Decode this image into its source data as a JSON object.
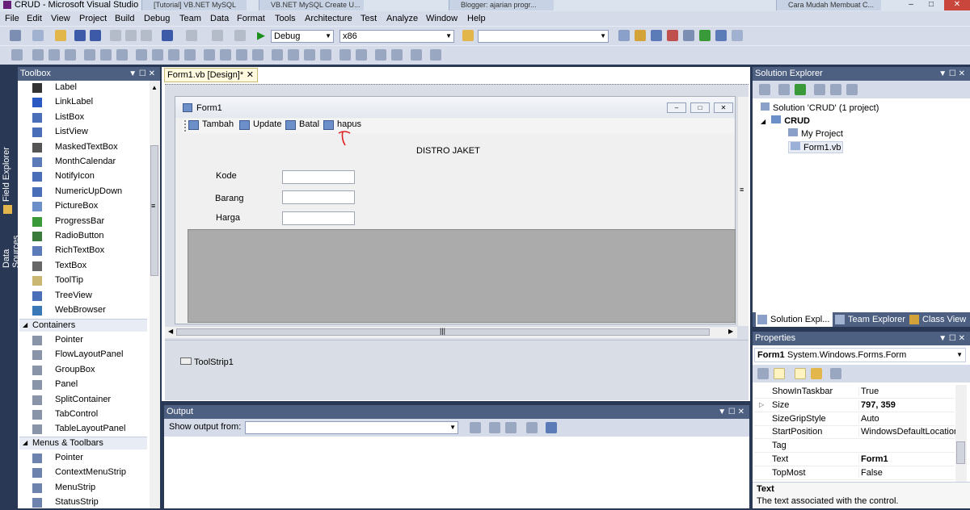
{
  "window": {
    "title": "CRUD - Microsoft Visual Studio",
    "browser_tabs": [
      "[Tutorial] VB.NET MySQL",
      "VB.NET MySQL Create U...",
      "Blogger: ajarian progr...",
      "Cara Mudah Membuat C..."
    ]
  },
  "menubar": {
    "items": [
      "File",
      "Edit",
      "View",
      "Project",
      "Build",
      "Debug",
      "Team",
      "Data",
      "Format",
      "Tools",
      "Architecture",
      "Test",
      "Analyze",
      "Window",
      "Help"
    ]
  },
  "toolbar": {
    "config": "Debug",
    "platform": "x86",
    "search": ""
  },
  "left_strip": {
    "items": [
      "Field Explorer",
      "Data Sources"
    ]
  },
  "toolbox": {
    "title": "Toolbox",
    "common_items": [
      "Label",
      "LinkLabel",
      "ListBox",
      "ListView",
      "MaskedTextBox",
      "MonthCalendar",
      "NotifyIcon",
      "NumericUpDown",
      "PictureBox",
      "ProgressBar",
      "RadioButton",
      "RichTextBox",
      "TextBox",
      "ToolTip",
      "TreeView",
      "WebBrowser"
    ],
    "containers_header": "Containers",
    "containers_items": [
      "Pointer",
      "FlowLayoutPanel",
      "GroupBox",
      "Panel",
      "SplitContainer",
      "TabControl",
      "TableLayoutPanel"
    ],
    "menus_header": "Menus & Toolbars",
    "menus_items": [
      "Pointer",
      "ContextMenuStrip",
      "MenuStrip",
      "StatusStrip"
    ]
  },
  "designer": {
    "tab_label": "Form1.vb [Design]*",
    "form_title": "Form1",
    "toolstrip_buttons": [
      "Tambah",
      "Update",
      "Batal",
      "hapus"
    ],
    "heading": "DISTRO JAKET",
    "fields": [
      {
        "label": "Kode",
        "value": ""
      },
      {
        "label": "Barang",
        "value": ""
      },
      {
        "label": "Harga",
        "value": ""
      }
    ],
    "tray_component": "ToolStrip1"
  },
  "output": {
    "title": "Output",
    "show_from_label": "Show output from:",
    "source": ""
  },
  "solution_explorer": {
    "title": "Solution Explorer",
    "solution": "Solution 'CRUD' (1 project)",
    "project": "CRUD",
    "items": [
      "My Project",
      "Form1.vb"
    ],
    "bottom_tabs": [
      "Solution Expl...",
      "Team Explorer",
      "Class View"
    ]
  },
  "properties": {
    "title": "Properties",
    "object_name": "Form1",
    "object_type": "System.Windows.Forms.Form",
    "rows": [
      {
        "name": "ShowInTaskbar",
        "value": "True",
        "bold": false
      },
      {
        "name": "Size",
        "value": "797, 359",
        "bold": true
      },
      {
        "name": "SizeGripStyle",
        "value": "Auto",
        "bold": false
      },
      {
        "name": "StartPosition",
        "value": "WindowsDefaultLocation",
        "bold": false
      },
      {
        "name": "Tag",
        "value": "",
        "bold": false
      },
      {
        "name": "Text",
        "value": "Form1",
        "bold": true
      },
      {
        "name": "TopMost",
        "value": "False",
        "bold": false
      }
    ],
    "desc_title": "Text",
    "desc_text": "The text associated with the control."
  },
  "colors": {
    "chrome_bg": "#293955",
    "panel_header": "#4d6082",
    "menubar_bg": "#d6dbe9",
    "active_tab": "#fff9e0"
  }
}
